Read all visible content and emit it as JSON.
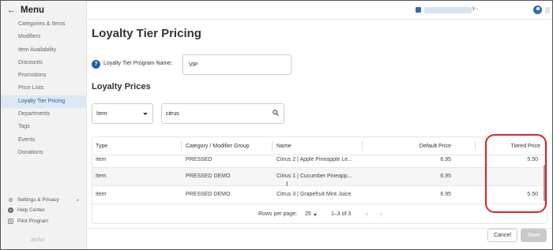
{
  "sidebar": {
    "title": "Menu",
    "items": [
      {
        "label": "Categories & Items",
        "active": false
      },
      {
        "label": "Modifiers",
        "active": false
      },
      {
        "label": "Item Availability",
        "active": false
      },
      {
        "label": "Discounts",
        "active": false
      },
      {
        "label": "Promotions",
        "active": false
      },
      {
        "label": "Price Lists",
        "active": false
      },
      {
        "label": "Loyalty Tier Pricing",
        "active": true
      },
      {
        "label": "Departments",
        "active": false
      },
      {
        "label": "Tags",
        "active": false
      },
      {
        "label": "Events",
        "active": false
      },
      {
        "label": "Donations",
        "active": false
      }
    ],
    "bottom": [
      {
        "label": "Settings & Privacy",
        "icon": "gear-icon"
      },
      {
        "label": "Help Center",
        "icon": "help-icon"
      },
      {
        "label": "Pilot Program",
        "icon": "list-icon"
      }
    ],
    "logo": "aloha"
  },
  "topbar": {
    "location_suffix": "y..."
  },
  "page": {
    "title": "Loyalty Tier Pricing",
    "program_name_label": "Loyalty Tier Program Name:",
    "program_name_value": "VIP",
    "section_title": "Loyalty Prices"
  },
  "filters": {
    "type_selected": "Item",
    "search_value": "citrus"
  },
  "table": {
    "headers": [
      "Type",
      "Category / Modifier Group",
      "Name",
      "Default Price",
      "Tiered Price"
    ],
    "rows": [
      {
        "type": "Item",
        "category": "PRESSED",
        "name": "Citrus 2 | Apple Pineapple Le...",
        "default_price": "6.95",
        "tiered_price": "5.50"
      },
      {
        "type": "Item",
        "category": "PRESSED DEMO",
        "name": "Citrus 1 | Cucumber Pineapp...",
        "default_price": "6.95",
        "tiered_price": ""
      },
      {
        "type": "Item",
        "category": "PRESSED DEMO",
        "name": "Citrus 3 | Grapefruit Mint Juice",
        "default_price": "6.95",
        "tiered_price": "5.50"
      }
    ]
  },
  "pagination": {
    "rows_per_page_label": "Rows per page:",
    "rows_per_page": "25",
    "range": "1–3 of 3"
  },
  "footer": {
    "cancel_label": "Cancel",
    "save_label": "Save"
  },
  "colors": {
    "accent": "#1f5fa6",
    "active_nav_bg": "#dde8f3",
    "highlight": "#e0202a"
  }
}
